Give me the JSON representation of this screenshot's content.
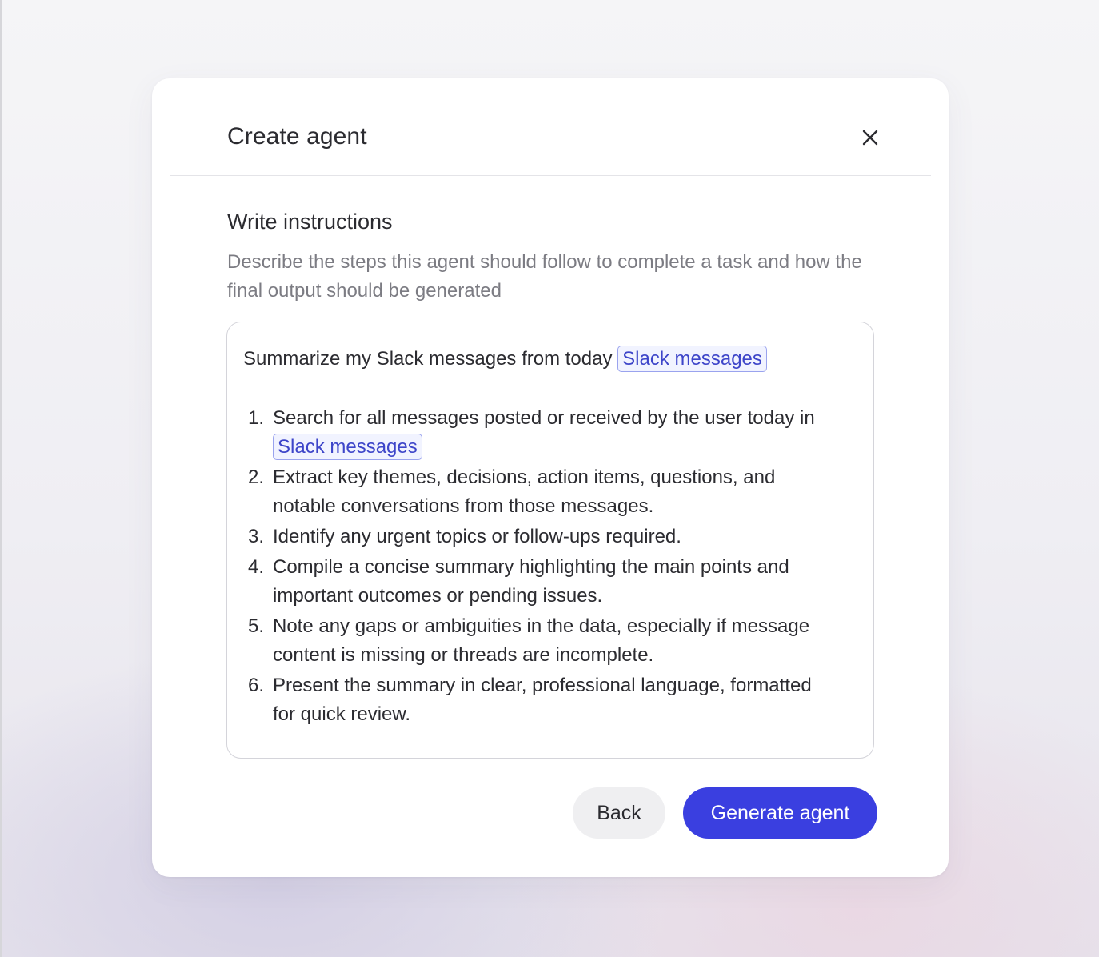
{
  "modal": {
    "title": "Create agent",
    "close_icon": "close-icon"
  },
  "section": {
    "title": "Write instructions",
    "description": "Describe the steps this agent should follow to complete a task and how the final output should be generated"
  },
  "instructions": {
    "intro": "Summarize my Slack messages from today",
    "intro_chip": "Slack messages",
    "steps": [
      {
        "number": "1.",
        "text_before": "Search for all messages posted or received by the user today in",
        "chip": "Slack messages"
      },
      {
        "number": "2.",
        "text": "Extract key themes, decisions, action items, questions, and notable conversations from those messages."
      },
      {
        "number": "3.",
        "text": "Identify any urgent topics or follow-ups required."
      },
      {
        "number": "4.",
        "text": "Compile a concise summary highlighting the main points and important outcomes or pending issues."
      },
      {
        "number": "5.",
        "text": "Note any gaps or ambiguities in the data, especially if message content is missing or threads are incomplete."
      },
      {
        "number": "6.",
        "text": "Present the summary in clear, professional language, formatted for quick review."
      }
    ]
  },
  "buttons": {
    "back_label": "Back",
    "generate_label": "Generate agent"
  },
  "colors": {
    "primary": "#3a3fe0",
    "chip_text": "#3d45c9",
    "chip_border": "#9aa3ee"
  }
}
